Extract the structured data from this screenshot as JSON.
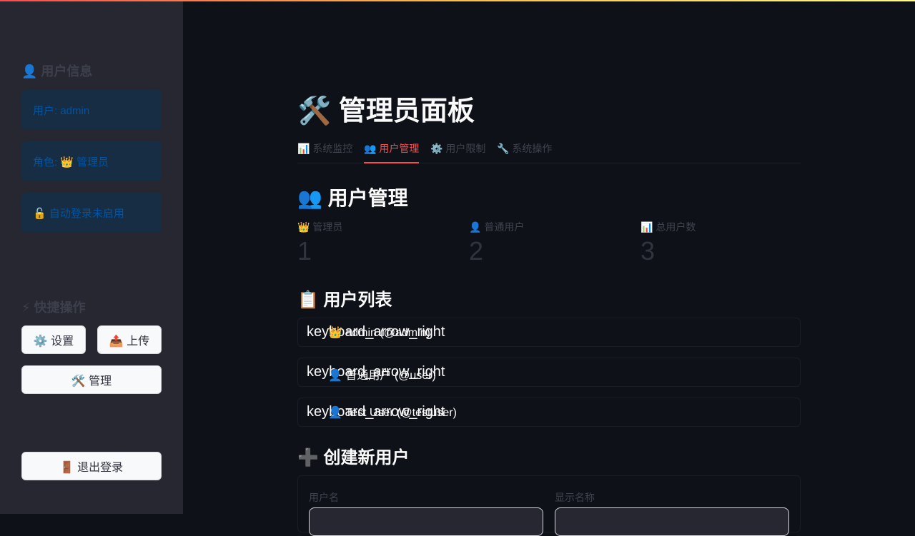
{
  "sidebar": {
    "user_info_title": "👤 用户信息",
    "user_line": "用户: admin",
    "role_line": "角色: 👑 管理员",
    "autologin_line": "🔓 自动登录未启用",
    "quick_actions_title": "⚡ 快捷操作",
    "settings_label": "⚙️ 设置",
    "upload_label": "📤 上传",
    "admin_label": "🛠️ 管理",
    "logout_label": "🚪 退出登录"
  },
  "main": {
    "title": "🛠️ 管理员面板",
    "tabs": [
      {
        "label": "📊 系统监控",
        "active": false
      },
      {
        "label": "👥 用户管理",
        "active": true
      },
      {
        "label": "⚙️ 用户限制",
        "active": false
      },
      {
        "label": "🔧 系统操作",
        "active": false
      }
    ],
    "section_title": "👥 用户管理",
    "metrics": [
      {
        "label": "👑 管理员",
        "value": "1"
      },
      {
        "label": "👤 普通用户",
        "value": "2"
      },
      {
        "label": "📊 总用户数",
        "value": "3"
      }
    ],
    "user_list_title": "📋 用户列表",
    "users": [
      {
        "icon_ligature": "keyboard_arrow_right",
        "text": "👑 admin (@admin)"
      },
      {
        "icon_ligature": "keyboard_arrow_right",
        "text": "👤 普通用户 (@user)"
      },
      {
        "icon_ligature": "keyboard_arrow_right",
        "text": "👤 Test User (@testuser)"
      }
    ],
    "create_title": "➕ 创建新用户",
    "form": {
      "username_label": "用户名",
      "display_name_label": "显示名称",
      "username_value": "",
      "display_name_value": ""
    }
  },
  "colors": {
    "accent": "#ff4b4b",
    "background": "#0e1117",
    "sidebar_bg": "#262730",
    "info_box_bg": "#172d43",
    "info_text": "#0054a3"
  }
}
